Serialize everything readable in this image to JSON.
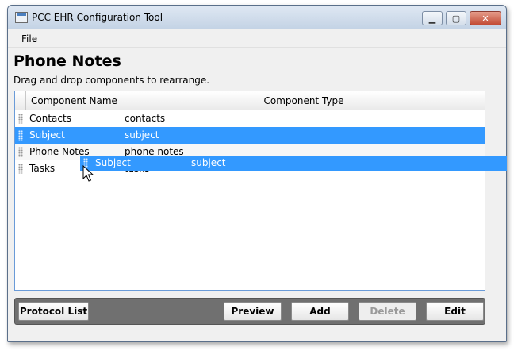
{
  "window": {
    "title": "PCC EHR Configuration Tool",
    "controls": {
      "minimize": "▁",
      "maximize": "▢",
      "close": "✕"
    }
  },
  "menu": {
    "file": "File"
  },
  "page": {
    "title": "Phone Notes",
    "instructions": "Drag and drop components to rearrange."
  },
  "table": {
    "columns": [
      "Component Name",
      "Component Type"
    ],
    "rows": [
      {
        "name": "Contacts",
        "type": "contacts",
        "selected": false
      },
      {
        "name": "Subject",
        "type": "subject",
        "selected": true
      },
      {
        "name": "Phone Notes",
        "type": "phone notes",
        "selected": false
      },
      {
        "name": "Tasks",
        "type": "tasks",
        "selected": false
      }
    ],
    "drag_ghost": {
      "name": "Subject",
      "type": "subject"
    }
  },
  "buttons": {
    "protocol_list": "Protocol List",
    "preview": "Preview",
    "add": "Add",
    "delete": "Delete",
    "edit": "Edit"
  },
  "colors": {
    "selection": "#3399ff",
    "table_border": "#6a9bd8",
    "button_bar": "#707070",
    "disabled_text": "#9a9a9a"
  },
  "icons": {
    "app": "app-icon",
    "row_handle": "drag-handle-icon",
    "cursor": "mouse-cursor-icon"
  }
}
